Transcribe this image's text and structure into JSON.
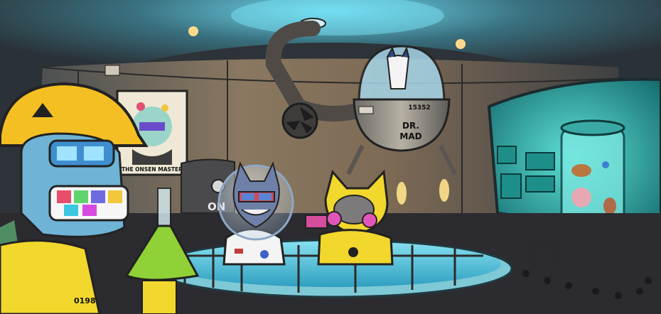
{
  "scene": {
    "poster_caption": "THE ONSEN MASTER",
    "pod_number": "15352",
    "pod_label_line1": "DR.",
    "pod_label_line2": "MAD",
    "wall_label_partial": "ON",
    "suit_number": "0198",
    "colors": {
      "ceiling": "#3f4a52",
      "wall": "#6b7277",
      "wall_warm": "#a0825f",
      "floor": "#2b2b30",
      "pool_water": "#4fc3dd",
      "pool_rim": "#7ec9d6",
      "lab_glow": "#2fb9b0",
      "hazmat_yellow": "#f2d72d",
      "helmet_yellow": "#f4bf22",
      "pink_filter": "#e255b8",
      "tube_liquid": "#8fd136"
    }
  }
}
